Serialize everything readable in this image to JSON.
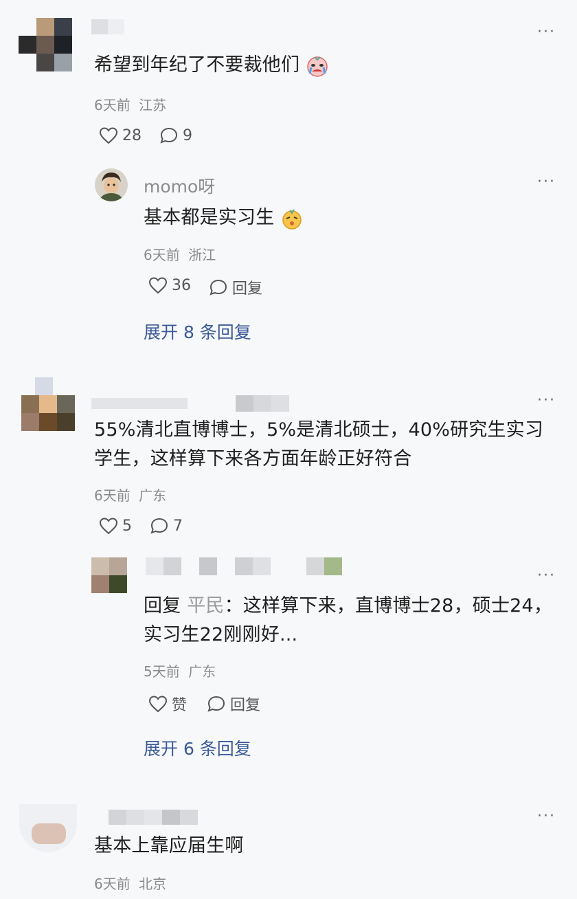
{
  "comments": [
    {
      "text": "希望到年纪了不要裁他们",
      "emoji": "crying-face-emoji",
      "time": "6天前",
      "location": "江苏",
      "likes": "28",
      "replies_count": "9",
      "reply": {
        "username": "momo呀",
        "text": "基本都是实习生",
        "emoji": "mischievous-face-emoji",
        "time": "6天前",
        "location": "浙江",
        "likes": "36",
        "reply_label": "回复"
      },
      "expand_label": "展开 8 条回复"
    },
    {
      "text_line1": "55%清北直博博士，5%是清北硕士，40%研究生实习",
      "text_line2": "学生，这样算下来各方面年龄正好符合",
      "time": "6天前",
      "location": "广东",
      "likes": "5",
      "replies_count": "7",
      "reply": {
        "reply_prefix": "回复",
        "reply_target": "平民",
        "text_line1": "：这样算下来，直博博士28，硕士24，",
        "text_line2": "实习生22刚刚好...",
        "time": "5天前",
        "location": "广东",
        "like_label": "赞",
        "reply_label": "回复"
      },
      "expand_label": "展开 6 条回复"
    },
    {
      "text": "基本上靠应届生啊",
      "time": "6天前",
      "location": "北京"
    }
  ],
  "more_icon": "···",
  "colors": {
    "link": "#3b5998",
    "meta": "#8a8a8a",
    "background": "#f7f8fa"
  }
}
